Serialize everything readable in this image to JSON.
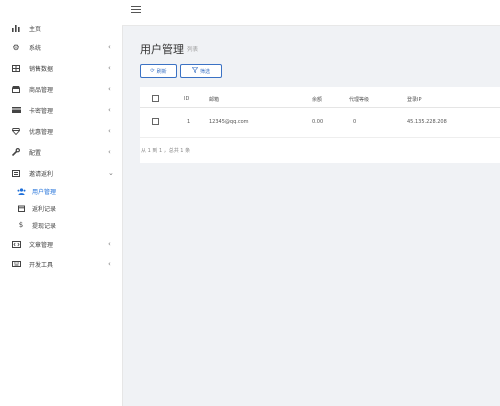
{
  "topbar": {
    "menu_icon": "hamburger-icon"
  },
  "sidebar": {
    "items": [
      {
        "label": "主页",
        "icon": "bar-chart-icon",
        "chevron": ""
      },
      {
        "label": "系统",
        "icon": "gear-icon",
        "chevron": "‹"
      },
      {
        "label": "销售数据",
        "icon": "grid-icon",
        "chevron": "‹"
      },
      {
        "label": "商品管理",
        "icon": "shop-icon",
        "chevron": "‹"
      },
      {
        "label": "卡密管理",
        "icon": "card-icon",
        "chevron": "‹"
      },
      {
        "label": "优惠管理",
        "icon": "gem-icon",
        "chevron": "‹"
      },
      {
        "label": "配置",
        "icon": "wrench-icon",
        "chevron": "‹"
      },
      {
        "label": "邀请返利",
        "icon": "list-icon",
        "chevron": "⌄"
      },
      {
        "label": "用户管理",
        "icon": "users-icon",
        "chevron": ""
      },
      {
        "label": "返利记录",
        "icon": "calendar-icon",
        "chevron": ""
      },
      {
        "label": "提现记录",
        "icon": "dollar-icon",
        "chevron": ""
      },
      {
        "label": "文章管理",
        "icon": "code-icon",
        "chevron": "‹"
      },
      {
        "label": "开发工具",
        "icon": "keyboard-icon",
        "chevron": "‹"
      }
    ]
  },
  "page": {
    "title": "用户管理",
    "subtitle": "列表"
  },
  "toolbar": {
    "refresh_label": "刷新",
    "filter_label": "筛选"
  },
  "table": {
    "columns": [
      "ID",
      "邮箱",
      "余额",
      "代理等级",
      "登录IP"
    ],
    "rows": [
      {
        "id": "1",
        "email": "12345@qq.com",
        "balance": "0.00",
        "level": "0",
        "ip": "45.135.228.208"
      }
    ]
  },
  "pagination": {
    "text": "从 1 到 1 ，总共 1 条"
  },
  "colors": {
    "accent": "#3b72c4",
    "active_nav": "#1e6fd9",
    "background": "#f0f2f5"
  }
}
